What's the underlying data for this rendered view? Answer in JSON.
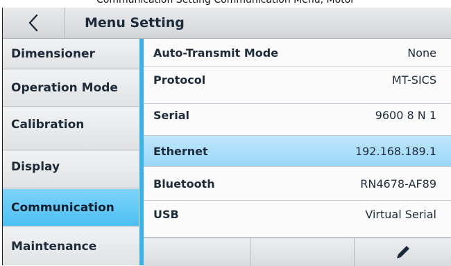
{
  "caption": "Communication Setting Communication Menu, Motor",
  "header": {
    "title": "Menu Setting",
    "back_icon": "chevron-left-icon"
  },
  "sidebar": {
    "items": [
      {
        "label": "Dimensioner",
        "active": false
      },
      {
        "label": "Operation Mode",
        "active": false
      },
      {
        "label": "Calibration",
        "active": false
      },
      {
        "label": "Display",
        "active": false
      },
      {
        "label": "Communication",
        "active": true
      },
      {
        "label": "Maintenance",
        "active": false
      }
    ]
  },
  "settings": {
    "rows": [
      {
        "label": "Auto-Transmit Mode",
        "value": "None",
        "active": false
      },
      {
        "label": "Protocol",
        "value": "MT-SICS",
        "active": false
      },
      {
        "label": "Serial",
        "value": "9600 8 N 1",
        "active": false
      },
      {
        "label": "Ethernet",
        "value": "192.168.189.1",
        "active": true
      },
      {
        "label": "Bluetooth",
        "value": "RN4678-AF89",
        "active": false
      },
      {
        "label": "USB",
        "value": "Virtual Serial",
        "active": false
      }
    ]
  },
  "toolbar": {
    "edit_icon": "pencil-icon"
  },
  "colors": {
    "accent": "#36b4ef",
    "active_item": "#4cc0f4",
    "active_row": "#9ad7f7"
  }
}
